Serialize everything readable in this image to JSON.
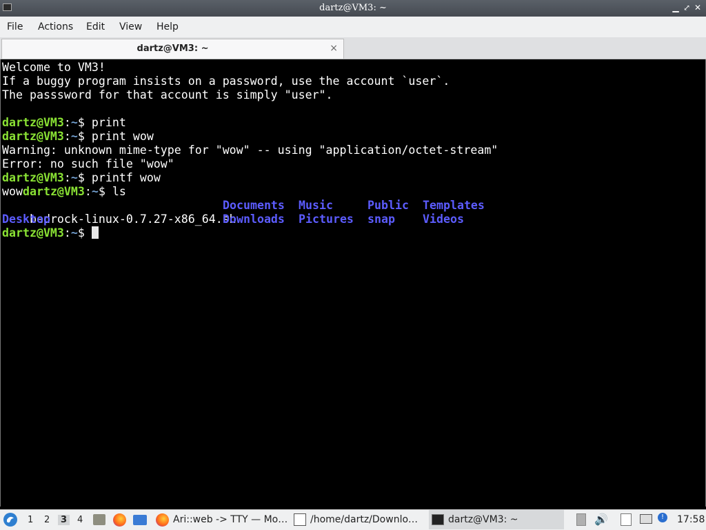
{
  "window": {
    "title": "dartz@VM3: ~"
  },
  "menu": [
    "File",
    "Actions",
    "Edit",
    "View",
    "Help"
  ],
  "tab": {
    "label": "dartz@VM3: ~",
    "close": "×"
  },
  "terminal": {
    "welcome": "Welcome to VM3!",
    "info1": "If a buggy program insists on a password, use the account `user`.",
    "info2": "The passsword for that account is simply \"user\".",
    "prompt_user": "dartz@VM3",
    "prompt_sep": ":",
    "prompt_path": "~",
    "prompt_dollar": "$",
    "cmd1": " print",
    "cmd2": " print wow",
    "warning": "Warning: unknown mime-type for \"wow\" -- using \"application/octet-stream\"",
    "error": "Error: no such file \"wow\"",
    "cmd3": " printf wow",
    "wow_output": "wow",
    "cmd4": " ls",
    "ls_file": "bedrock-linux-0.7.27-x86_64.sh",
    "ls_dirs": [
      "Desktop",
      "Documents",
      "Downloads",
      "Music",
      "Pictures",
      "Public",
      "snap",
      "Templates",
      "Videos"
    ]
  },
  "taskbar": {
    "workspaces": [
      "1",
      "2",
      "3",
      "4"
    ],
    "current_workspace": "3",
    "tasks": [
      {
        "label": "Ari::web -> TTY — Mo…",
        "icon": "firefox-icon"
      },
      {
        "label": "/home/dartz/Downlo…",
        "icon": "text-editor-icon"
      },
      {
        "label": "dartz@VM3: ~",
        "icon": "terminal-icon"
      }
    ],
    "clock": "17:58"
  }
}
